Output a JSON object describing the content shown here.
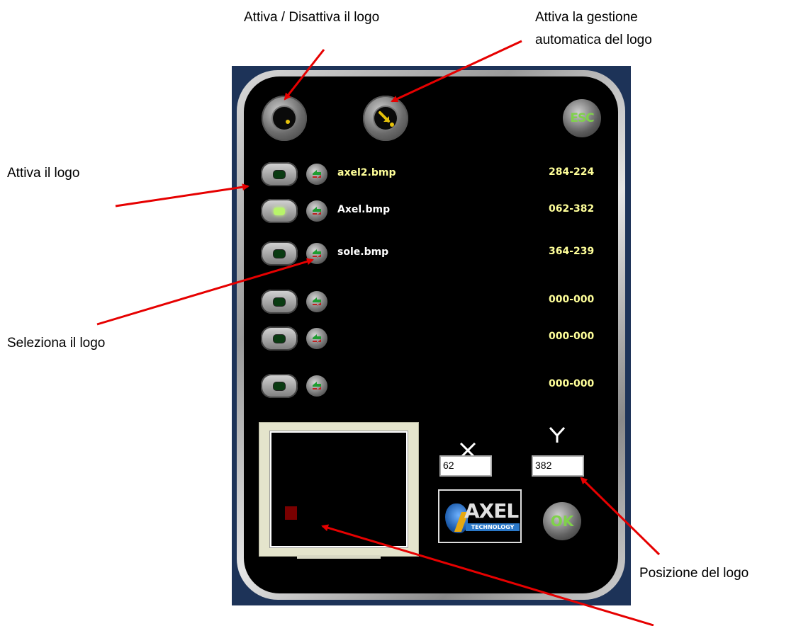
{
  "callouts": {
    "toggle_logo": "Attiva / Disattiva il logo",
    "auto_line1": "Attiva la gestione",
    "auto_line2": "automatica del logo",
    "activate": "Attiva il logo",
    "select": "Seleziona il logo",
    "position": "Posizione del logo"
  },
  "toolbar": {
    "toggle_icon": "monitor-dot-icon",
    "auto_icon": "auto-arrow-icon",
    "esc_label": "ESC"
  },
  "logos": [
    {
      "name": "axel2.bmp",
      "position": "284-224",
      "active": false
    },
    {
      "name": "Axel.bmp",
      "position": "062-382",
      "active": true
    },
    {
      "name": "sole.bmp",
      "position": "364-239",
      "active": false
    },
    {
      "name": "",
      "position": "000-000",
      "active": false
    },
    {
      "name": "",
      "position": "000-000",
      "active": false
    },
    {
      "name": "",
      "position": "000-000",
      "active": false
    }
  ],
  "coords": {
    "x_label": "X",
    "y_label": "Y",
    "x_value": "62",
    "y_value": "382"
  },
  "brand": {
    "name": "AXEL",
    "tagline": "TECHNOLOGY"
  },
  "ok_label": "OK",
  "colors": {
    "arrow": "#e60000",
    "position_text": "#ffff99",
    "button_text": "#7fd24a"
  }
}
